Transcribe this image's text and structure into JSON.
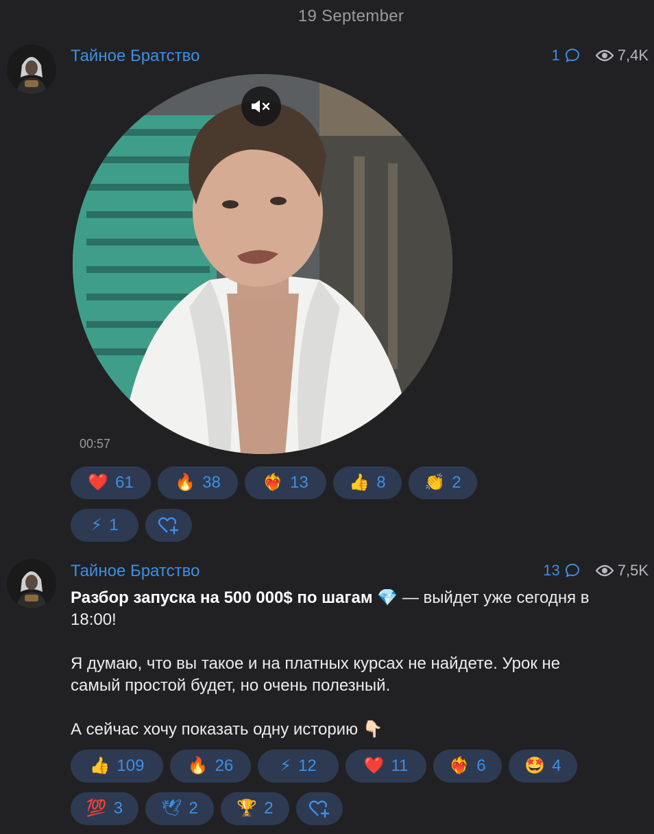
{
  "date_separator": "19 September",
  "posts": [
    {
      "channel": "Тайное Братство",
      "comments": "1",
      "views": "7,4K",
      "video_duration": "00:57",
      "reactions": [
        {
          "emoji": "❤️",
          "count": "61"
        },
        {
          "emoji": "🔥",
          "count": "38"
        },
        {
          "emoji": "❤️‍🔥",
          "count": "13"
        },
        {
          "emoji": "👍",
          "count": "8"
        },
        {
          "emoji": "👏",
          "count": "2"
        },
        {
          "emoji": "⚡",
          "count": "1"
        }
      ]
    },
    {
      "channel": "Тайное Братство",
      "comments": "13",
      "views": "7,5K",
      "text": {
        "bold": "Разбор запуска на 500 000$ по шагам",
        "gem": "💎",
        "rest": " — выйдет уже сегодня в 18:00!",
        "para2": "Я думаю, что вы такое и на платных курсах не найдете. Урок не самый простой будет, но очень полезный.",
        "para3": "А сейчас хочу показать одну историю ",
        "para3_emoji": "👇🏻"
      },
      "reactions": [
        {
          "emoji": "👍",
          "count": "109"
        },
        {
          "emoji": "🔥",
          "count": "26"
        },
        {
          "emoji": "⚡",
          "count": "12"
        },
        {
          "emoji": "❤️",
          "count": "11"
        },
        {
          "emoji": "❤️‍🔥",
          "count": "6"
        },
        {
          "emoji": "🤩",
          "count": "4"
        },
        {
          "emoji": "💯",
          "count": "3"
        },
        {
          "emoji": "🕊",
          "count": "2"
        },
        {
          "emoji": "🏆",
          "count": "2"
        }
      ]
    }
  ],
  "colors": {
    "background": "#212123",
    "accent": "#3d8fe6",
    "reaction_pill": "#2d3a52"
  }
}
